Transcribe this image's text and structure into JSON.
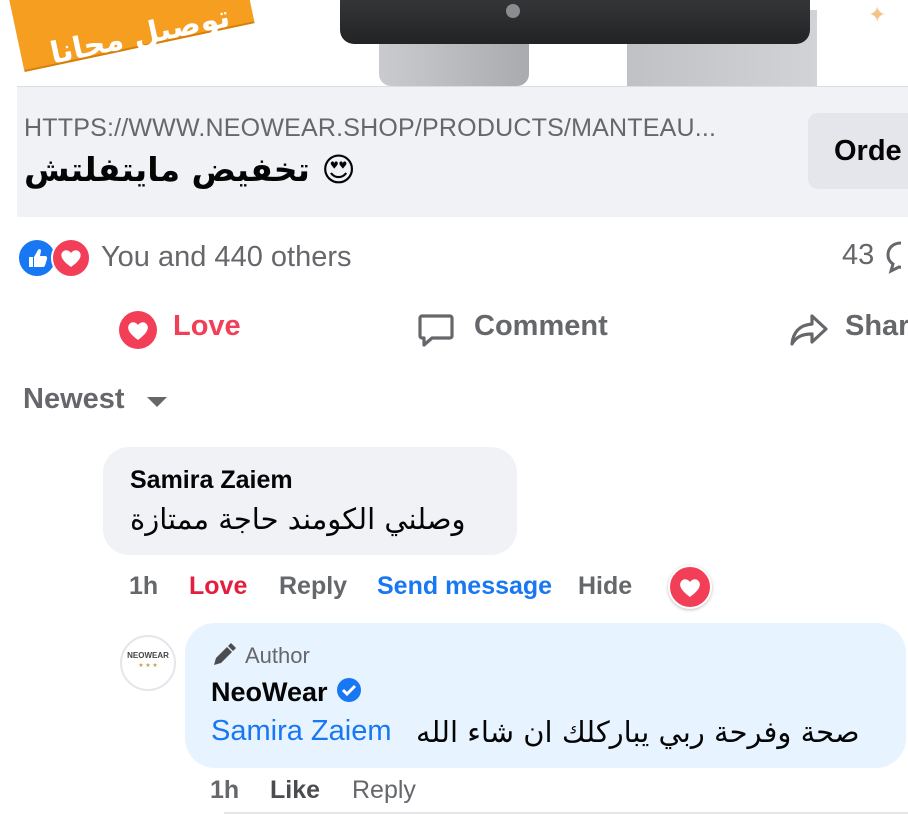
{
  "ad": {
    "badge_text": "توصيل مجانا"
  },
  "link_preview": {
    "url": "HTTPS://WWW.NEOWEAR.SHOP/PRODUCTS/MANTEAU...",
    "title": "تخفيض مايتفلتش 😍",
    "cta_label": "Orde"
  },
  "reactions": {
    "summary": "You and 440 others",
    "comment_count": "43",
    "icons": [
      "like-icon",
      "love-icon"
    ]
  },
  "actions": {
    "love_label": "Love",
    "comment_label": "Comment",
    "share_label": "Shar"
  },
  "sort": {
    "label": "Newest"
  },
  "comments": [
    {
      "author": "Samira Zaiem",
      "text": "وصلني الكومند حاجة ممتازة",
      "time": "1h",
      "love_label": "Love",
      "reply_label": "Reply",
      "send_message_label": "Send message",
      "hide_label": "Hide",
      "reaction_icon": "love-icon"
    }
  ],
  "reply": {
    "badge_label": "Author",
    "author": "NeoWear",
    "avatar_text": "NEOWEAR",
    "mention": "Samira Zaiem",
    "text": "صحة وفرحة ربي يباركلك ان شاء الله",
    "time": "1h",
    "like_label": "Like",
    "reply_label": "Reply"
  },
  "colors": {
    "brand_blue": "#1877f2",
    "love_red": "#f33e58",
    "muted_text": "#65676b",
    "bubble_gray": "#f0f2f5",
    "author_bubble": "#e7f3ff",
    "badge_orange": "#f59e1f"
  }
}
